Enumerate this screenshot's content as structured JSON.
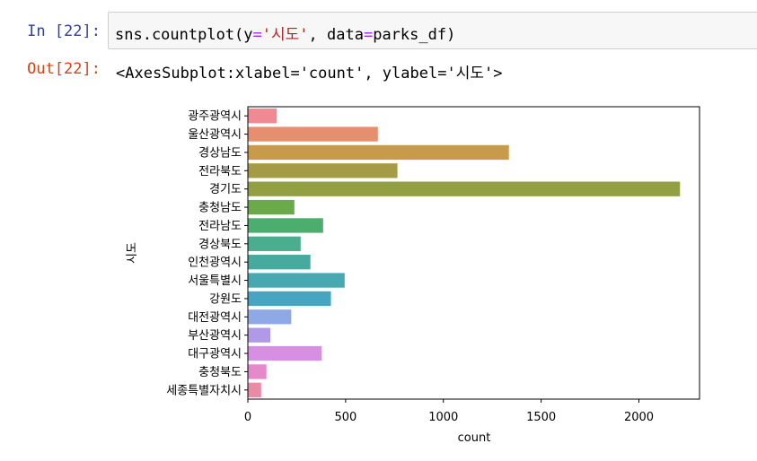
{
  "cell": {
    "in_prompt": "In [22]:",
    "code": {
      "t1": "sns.countplot(y",
      "t2": "=",
      "t3": "'시도'",
      "t4": ", data",
      "t5": "=",
      "t6": "parks_df)"
    },
    "out_prompt": "Out[22]:",
    "output_text": "<AxesSubplot:xlabel='count', ylabel='시도'>"
  },
  "chart_data": {
    "type": "bar",
    "orientation": "horizontal",
    "categories": [
      "광주광역시",
      "울산광역시",
      "경상남도",
      "전라북도",
      "경기도",
      "충청남도",
      "전라남도",
      "경상북도",
      "인천광역시",
      "서울특별시",
      "강원도",
      "대전광역시",
      "부산광역시",
      "대구광역시",
      "충청북도",
      "세종특별자치시"
    ],
    "values": [
      148,
      665,
      1335,
      765,
      2210,
      238,
      385,
      270,
      320,
      495,
      425,
      222,
      115,
      378,
      95,
      68
    ],
    "colors": [
      "#ef8a93",
      "#e58f6e",
      "#c89b4a",
      "#a59a45",
      "#92a043",
      "#6aaa4a",
      "#4bae6f",
      "#49ad8e",
      "#47aa9f",
      "#47a8b1",
      "#48a5c1",
      "#8ea9e6",
      "#b09ae8",
      "#d68fe2",
      "#e48acb",
      "#e98aa7"
    ],
    "xlabel": "count",
    "ylabel": "시도",
    "xlim": [
      0,
      2310
    ],
    "xticks": [
      0,
      500,
      1000,
      1500,
      2000
    ]
  }
}
